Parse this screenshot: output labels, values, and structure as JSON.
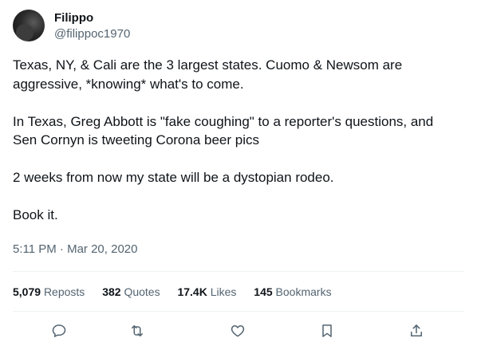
{
  "author": {
    "display_name": "Filippo",
    "handle": "@filippoc1970"
  },
  "tweet": {
    "paragraphs": [
      "Texas, NY, & Cali are the 3 largest states. Cuomo & Newsom are aggressive, *knowing* what's to come.",
      "In Texas, Greg Abbott is \"fake coughing\" to a reporter's questions, and Sen Cornyn is tweeting Corona beer pics",
      "2 weeks from now my state will be a dystopian rodeo.",
      "Book it."
    ],
    "timestamp": "5:11 PM · Mar 20, 2020"
  },
  "stats": {
    "reposts_count": "5,079",
    "reposts_label": "Reposts",
    "quotes_count": "382",
    "quotes_label": "Quotes",
    "likes_count": "17.4K",
    "likes_label": "Likes",
    "bookmarks_count": "145",
    "bookmarks_label": "Bookmarks"
  },
  "actions": {
    "icons": [
      "reply-icon",
      "repost-icon",
      "like-icon",
      "bookmark-icon",
      "share-icon"
    ]
  },
  "colors": {
    "text": "#0f1419",
    "secondary": "#536471",
    "divider": "#eff3f4"
  }
}
